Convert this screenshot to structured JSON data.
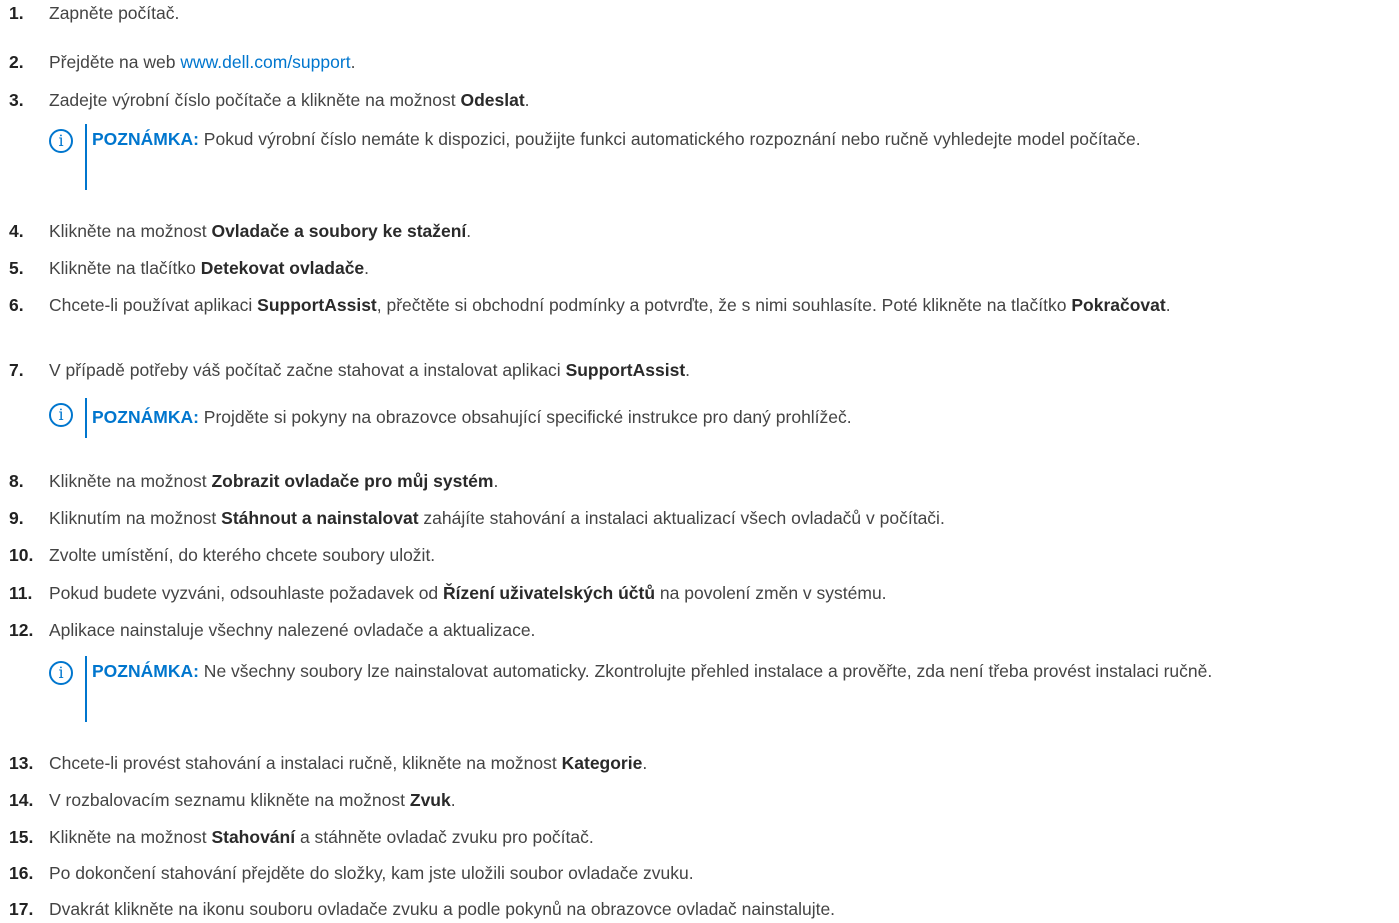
{
  "steps": [
    {
      "num": "1.",
      "parts": [
        {
          "t": "Zapněte počítač."
        }
      ]
    },
    {
      "num": "2.",
      "parts": [
        {
          "t": "Přejděte na web "
        },
        {
          "t": "www.dell.com/support",
          "link": true
        },
        {
          "t": "."
        }
      ]
    },
    {
      "num": "3.",
      "parts": [
        {
          "t": "Zadejte výrobní číslo počítače a klikněte na možnost "
        },
        {
          "t": "Odeslat",
          "b": true
        },
        {
          "t": "."
        }
      ]
    },
    {
      "num": "4.",
      "parts": [
        {
          "t": "Klikněte na možnost "
        },
        {
          "t": "Ovladače a soubory ke stažení",
          "b": true
        },
        {
          "t": "."
        }
      ]
    },
    {
      "num": "5.",
      "parts": [
        {
          "t": "Klikněte na tlačítko "
        },
        {
          "t": "Detekovat ovladače",
          "b": true
        },
        {
          "t": "."
        }
      ]
    },
    {
      "num": "6.",
      "parts": [
        {
          "t": "Chcete-li používat aplikaci "
        },
        {
          "t": "SupportAssist",
          "b": true
        },
        {
          "t": ", přečtěte si obchodní podmínky a potvrďte, že s nimi souhlasíte. Poté klikněte na tlačítko "
        },
        {
          "t": "Pokračovat",
          "b": true
        },
        {
          "t": "."
        }
      ]
    },
    {
      "num": "7.",
      "parts": [
        {
          "t": "V případě potřeby váš počítač začne stahovat a instalovat aplikaci "
        },
        {
          "t": "SupportAssist",
          "b": true
        },
        {
          "t": "."
        }
      ]
    },
    {
      "num": "8.",
      "parts": [
        {
          "t": "Klikněte na možnost "
        },
        {
          "t": "Zobrazit ovladače pro můj systém",
          "b": true
        },
        {
          "t": "."
        }
      ]
    },
    {
      "num": "9.",
      "parts": [
        {
          "t": "Kliknutím na možnost "
        },
        {
          "t": "Stáhnout a nainstalovat",
          "b": true
        },
        {
          "t": " zahájíte stahování a instalaci aktualizací všech ovladačů v počítači."
        }
      ]
    },
    {
      "num": "10.",
      "parts": [
        {
          "t": "Zvolte umístění, do kterého chcete soubory uložit."
        }
      ]
    },
    {
      "num": "11.",
      "parts": [
        {
          "t": "Pokud budete vyzváni, odsouhlaste požadavek od "
        },
        {
          "t": "Řízení uživatelských účtů",
          "b": true
        },
        {
          "t": " na povolení změn v systému."
        }
      ]
    },
    {
      "num": "12.",
      "parts": [
        {
          "t": "Aplikace nainstaluje všechny nalezené ovladače a aktualizace."
        }
      ]
    },
    {
      "num": "13.",
      "parts": [
        {
          "t": "Chcete-li provést stahování a instalaci ručně, klikněte na možnost "
        },
        {
          "t": "Kategorie",
          "b": true
        },
        {
          "t": "."
        }
      ]
    },
    {
      "num": "14.",
      "parts": [
        {
          "t": "V rozbalovacím seznamu klikněte na možnost "
        },
        {
          "t": "Zvuk",
          "b": true
        },
        {
          "t": "."
        }
      ]
    },
    {
      "num": "15.",
      "parts": [
        {
          "t": "Klikněte na možnost "
        },
        {
          "t": "Stahování",
          "b": true
        },
        {
          "t": " a stáhněte ovladač zvuku pro počítač."
        }
      ]
    },
    {
      "num": "16.",
      "parts": [
        {
          "t": "Po dokončení stahování přejděte do složky, kam jste uložili soubor ovladače zvuku."
        }
      ]
    },
    {
      "num": "17.",
      "parts": [
        {
          "t": "Dvakrát klikněte na ikonu souboru ovladače zvuku a podle pokynů na obrazovce ovladač nainstalujte."
        }
      ]
    }
  ],
  "notes": [
    {
      "label": "POZNÁMKA:",
      "text": " Pokud výrobní číslo nemáte k dispozici, použijte funkci automatického rozpoznání nebo ručně vyhledejte model počítače."
    },
    {
      "label": "POZNÁMKA:",
      "text": " Projděte si pokyny na obrazovce obsahující specifické instrukce pro daný prohlížeč."
    },
    {
      "label": "POZNÁMKA:",
      "text": " Ne všechny soubory lze nainstalovat automaticky. Zkontrolujte přehled instalace a prověřte, zda není třeba provést instalaci ručně."
    }
  ],
  "note_icon_glyph": "i",
  "colors": {
    "link": "#0076ce",
    "note_accent": "#0076ce",
    "text": "#444444"
  }
}
